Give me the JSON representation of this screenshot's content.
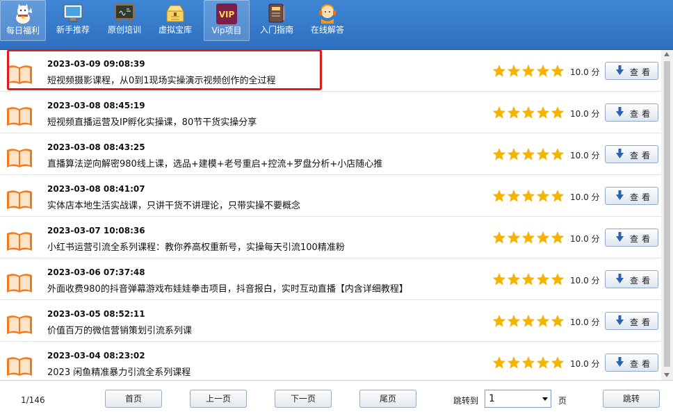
{
  "toolbar": {
    "items": [
      {
        "label": "每日福利",
        "icon": "lucky-cat-icon",
        "active": true
      },
      {
        "label": "新手推荐",
        "icon": "monitor-icon",
        "active": false
      },
      {
        "label": "原创培训",
        "icon": "chalkboard-icon",
        "active": false
      },
      {
        "label": "虚拟宝库",
        "icon": "treasure-chest-icon",
        "active": false
      },
      {
        "label": "Vip项目",
        "icon": "vip-icon",
        "icon_text": "VIP",
        "active": true
      },
      {
        "label": "入门指南",
        "icon": "guide-book-icon",
        "active": false
      },
      {
        "label": "在线解答",
        "icon": "support-agent-icon",
        "active": false
      }
    ]
  },
  "list": {
    "view_label": "查看",
    "score_unit": "分",
    "rows": [
      {
        "date": "2023-03-09 09:08:39",
        "title": "短视频摄影课程，从0到1现场实操演示视频创作的全过程",
        "score": "10.0",
        "stars": 5,
        "highlighted": true
      },
      {
        "date": "2023-03-08 08:45:19",
        "title": "短视频直播运营及IP孵化实操课，80节干货实操分享",
        "score": "10.0",
        "stars": 5
      },
      {
        "date": "2023-03-08 08:43:25",
        "title": "直播算法逆向解密980线上课，选品+建模+老号重启+控流+罗盘分析+小店随心推",
        "score": "10.0",
        "stars": 5
      },
      {
        "date": "2023-03-08 08:41:07",
        "title": "实体店本地生活实战课，只讲干货不讲理论，只带实操不要概念",
        "score": "10.0",
        "stars": 5
      },
      {
        "date": "2023-03-07 10:08:36",
        "title": "小红书运营引流全系列课程：教你养高权重新号，实操每天引流100精准粉",
        "score": "10.0",
        "stars": 5
      },
      {
        "date": "2023-03-06 07:37:48",
        "title": "外面收费980的抖音弹幕游戏布娃娃拳击项目，抖音报白，实时互动直播【内含详细教程】",
        "score": "10.0",
        "stars": 5
      },
      {
        "date": "2023-03-05 08:52:11",
        "title": "价值百万的微信营销策划引流系列课",
        "score": "10.0",
        "stars": 5
      },
      {
        "date": "2023-03-04 08:23:02",
        "title": "2023 闲鱼精准暴力引流全系列课程",
        "score": "10.0",
        "stars": 5
      }
    ]
  },
  "footer": {
    "page_info": "1/146",
    "first": "首页",
    "prev": "上一页",
    "next": "下一页",
    "last": "尾页",
    "jump_label": "跳转到",
    "jump_value": "1",
    "page_unit": "页",
    "jump_button": "跳转"
  },
  "colors": {
    "toolbar": "#3278c8",
    "highlight": "#e11b1b",
    "star": "#f4b400",
    "book": "#f07a1e"
  }
}
